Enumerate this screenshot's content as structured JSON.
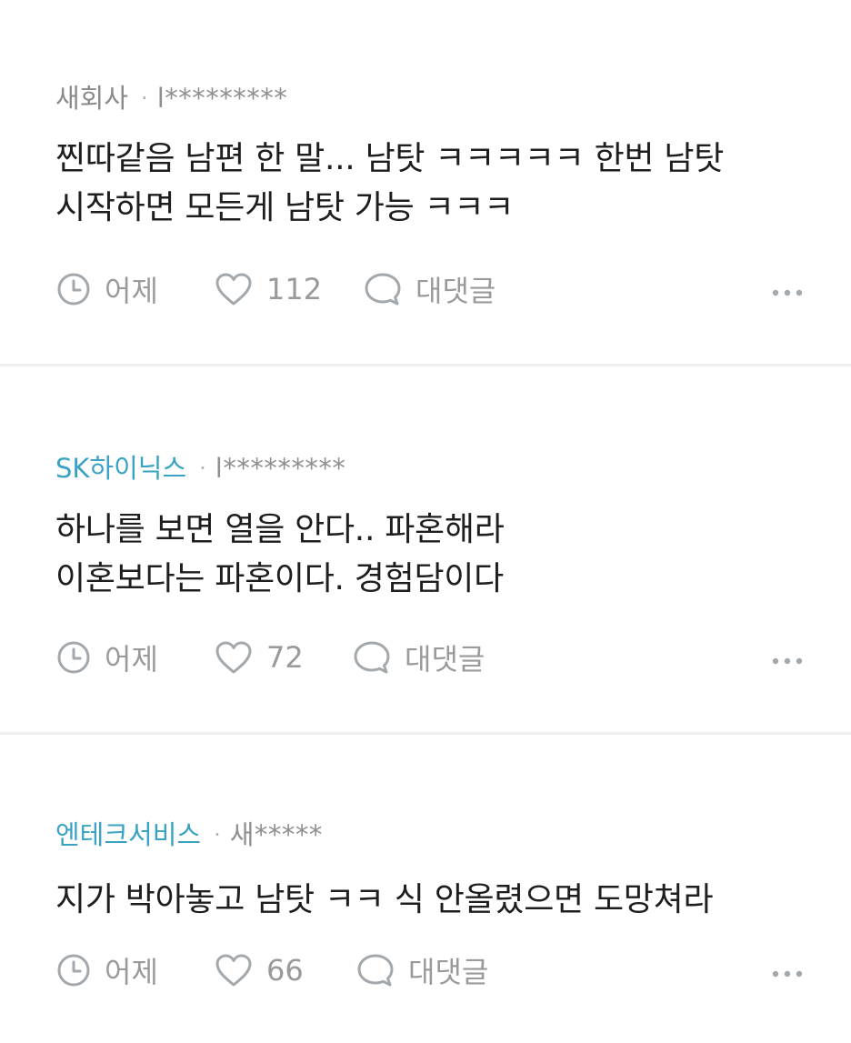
{
  "comments": [
    {
      "company": "새회사",
      "company_linked": false,
      "author": "l*********",
      "lines": [
        "찐따같음 남편 한 말... 남탓 ㅋㅋㅋㅋㅋ 한번 남탓",
        "시작하면 모든게 남탓 가능 ㅋㅋㅋ"
      ],
      "time": "어제",
      "likes": "112",
      "reply_label": "대댓글"
    },
    {
      "company": "SK하이닉스",
      "company_linked": true,
      "author": "l*********",
      "lines": [
        "하나를 보면 열을 안다.. 파혼해라",
        "이혼보다는 파혼이다. 경험담이다"
      ],
      "time": "어제",
      "likes": "72",
      "reply_label": "대댓글"
    },
    {
      "company": "엔테크서비스",
      "company_linked": true,
      "author": "새*****",
      "lines": [
        "지가 박아놓고 남탓 ㅋㅋ 식 안올렸으면 도망쳐라"
      ],
      "time": "어제",
      "likes": "66",
      "reply_label": "대댓글"
    }
  ],
  "separator": "·",
  "icons": {
    "time": "clock-icon",
    "like": "heart-icon",
    "reply": "speech-bubble-icon",
    "more": "more-dots-icon"
  },
  "colors": {
    "company_link": "#3aa3c3",
    "muted": "#8a8a8a",
    "text": "#1e1e1e",
    "icon": "#a3a8ad",
    "divider": "#efefef"
  }
}
